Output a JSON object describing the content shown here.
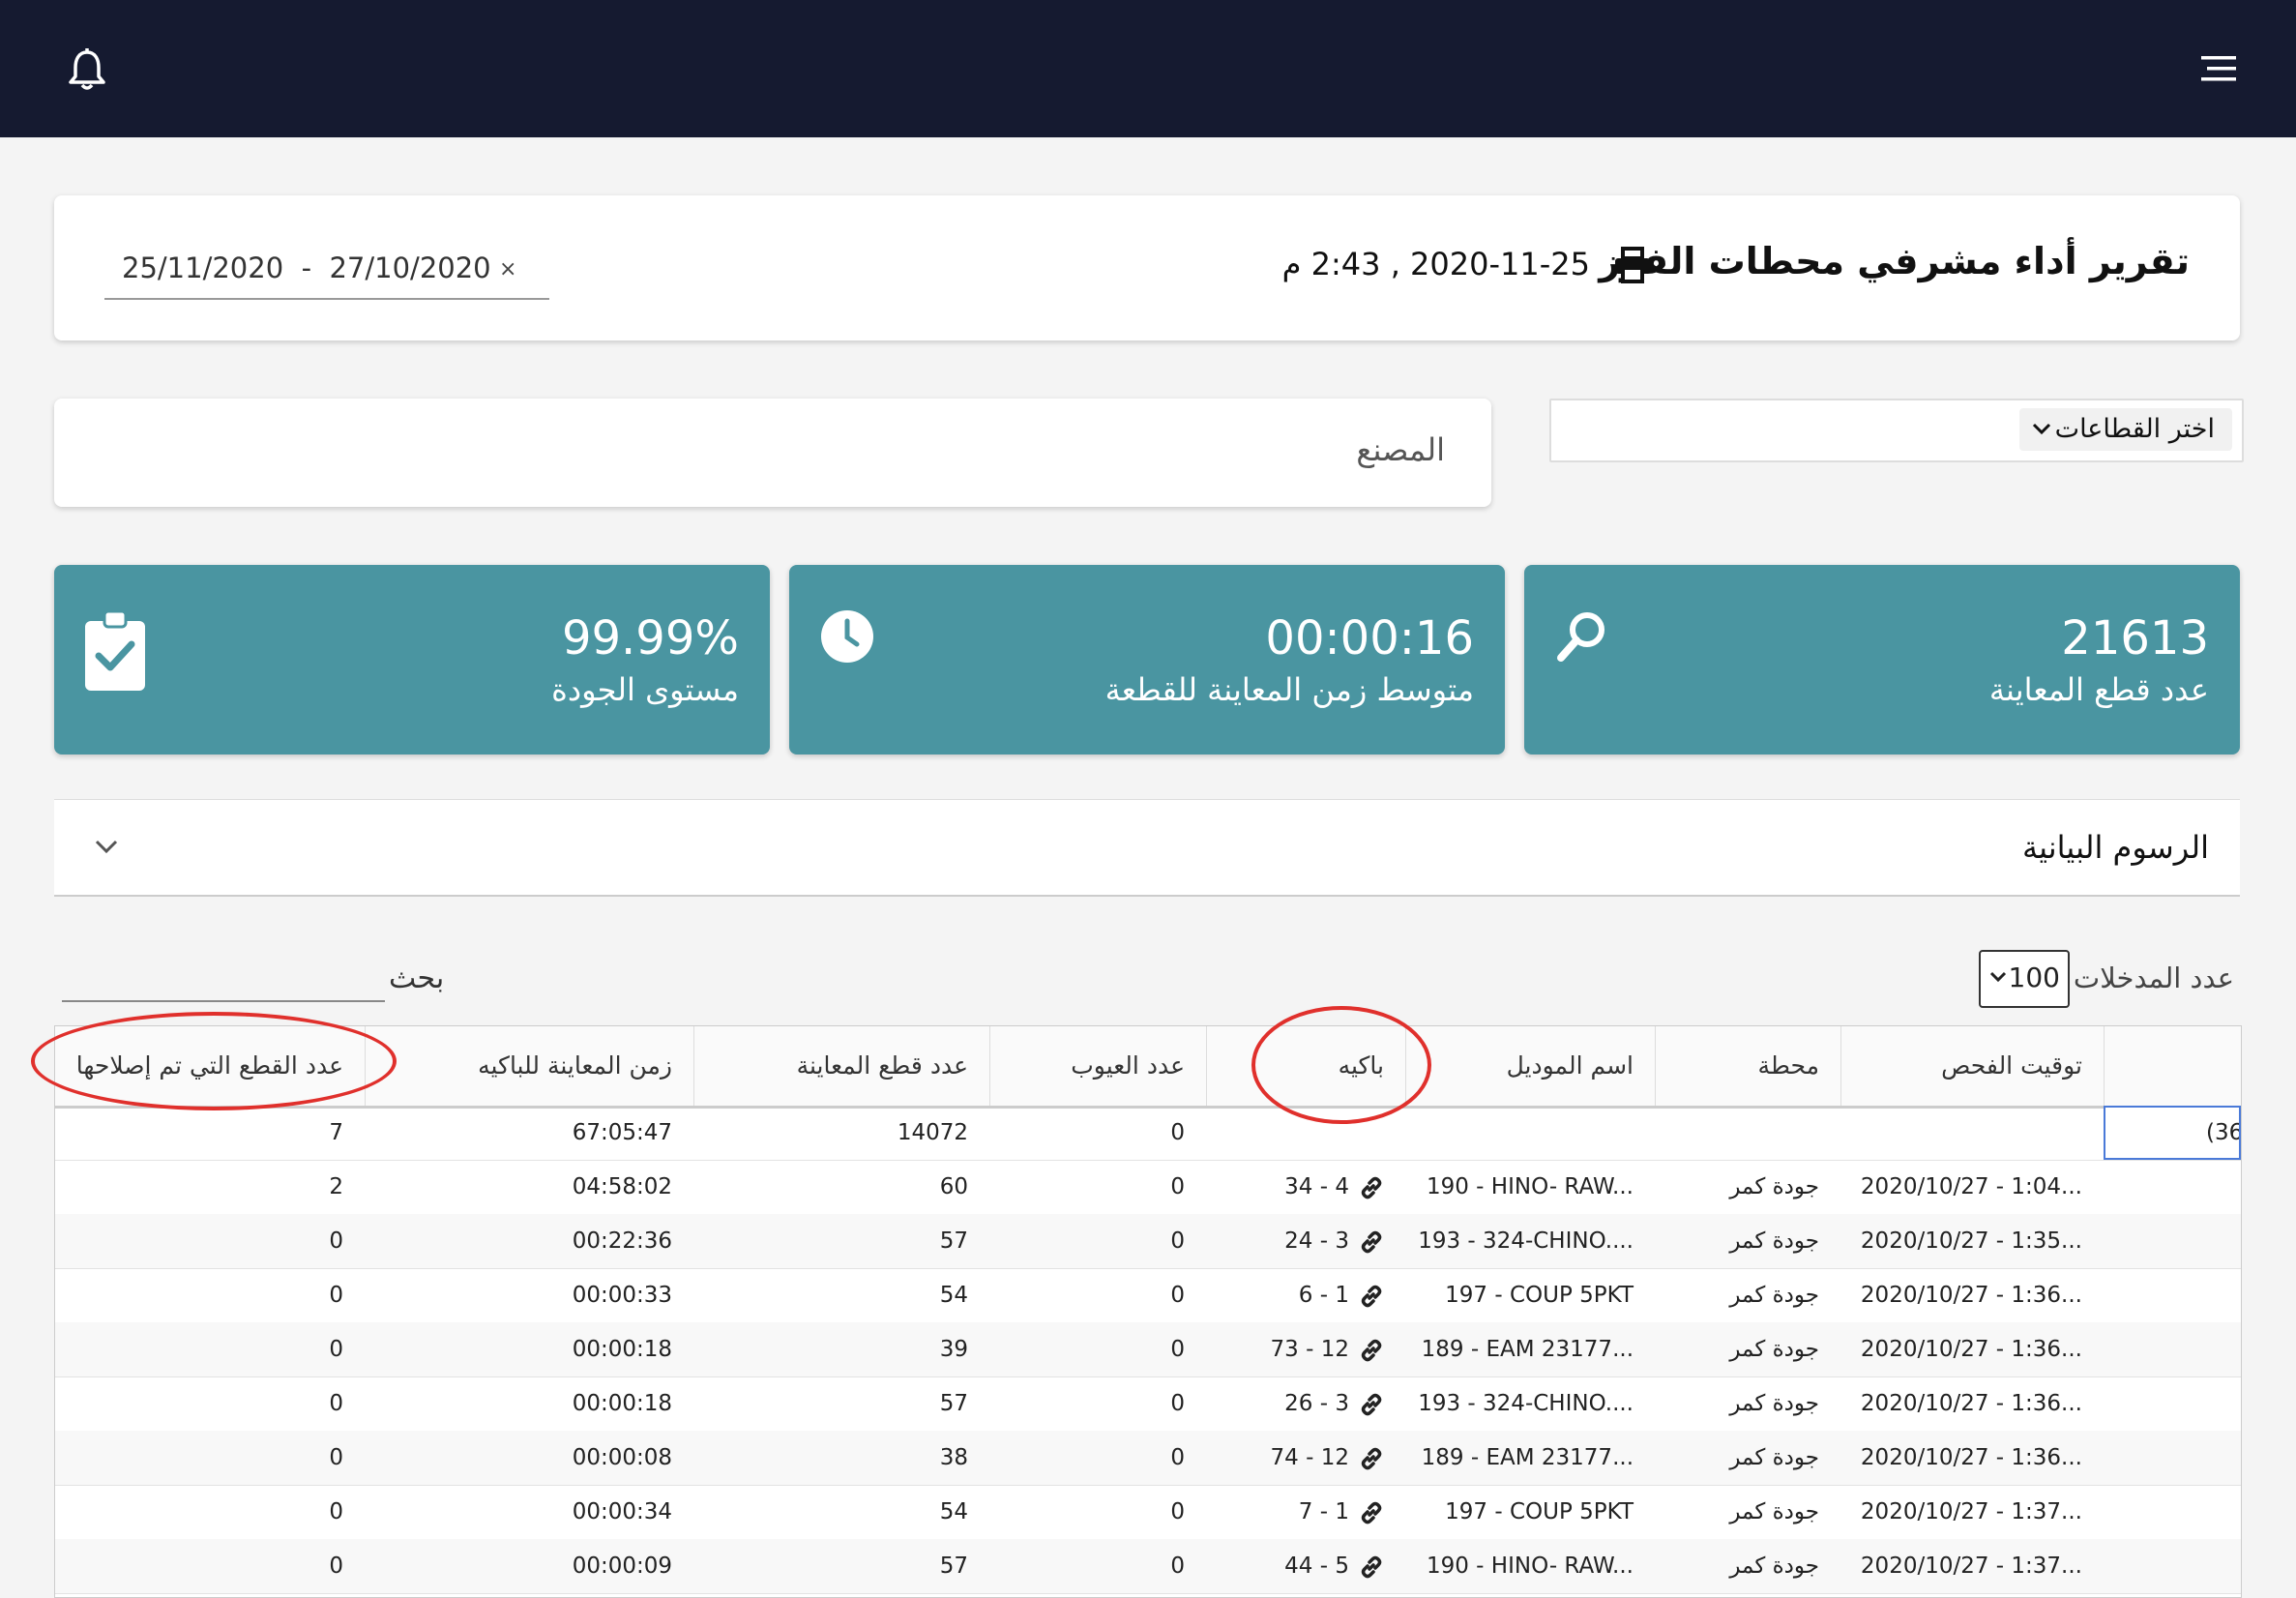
{
  "header": {
    "title": "تقرير أداء مشرفي محطات الفرز",
    "timestamp": "2020-11-25 , 2:43 م",
    "date_range": "25/11/2020  -  27/10/2020",
    "clear_symbol": "×"
  },
  "filters": {
    "sectors_label": "اختر القطاعات",
    "factory_label": "المصنع"
  },
  "stats": [
    {
      "value": "21613",
      "label": "عدد قطع المعاينة",
      "icon": "search-icon"
    },
    {
      "value": "00:00:16",
      "label": "متوسط زمن المعاينة للقطعة",
      "icon": "clock-icon"
    },
    {
      "value": "99.99%",
      "label": "مستوى الجودة",
      "icon": "clipboard-check-icon"
    }
  ],
  "charts": {
    "label": "الرسوم البيانية"
  },
  "table_controls": {
    "entries_label": "عدد المدخلات",
    "entries_value": "100",
    "search_label": "بحث"
  },
  "table": {
    "columns": [
      "توقيت الفحص",
      "محطة",
      "اسم الموديل",
      "باكيه",
      "عدد العيوب",
      "عدد قطع المعاينة",
      "زمن المعاينة للباكيه",
      "عدد القطع التي تم إصلاحها"
    ],
    "total_row": {
      "filter_value": "(36",
      "defects": "0",
      "pieces": "14072",
      "time": "67:05:47",
      "repaired": "7"
    },
    "rows": [
      {
        "time": "2020/10/27 - 1:04...",
        "station": "جودة كمر",
        "model": "190 - HINO- RAW...",
        "bundle": "34 - 4",
        "defects": "0",
        "pieces": "60",
        "duration": "04:58:02",
        "repaired": "2"
      },
      {
        "time": "2020/10/27 - 1:35...",
        "station": "جودة كمر",
        "model": "193 - 324-CHINO....",
        "bundle": "24 - 3",
        "defects": "0",
        "pieces": "57",
        "duration": "00:22:36",
        "repaired": "0"
      },
      {
        "time": "2020/10/27 - 1:36...",
        "station": "جودة كمر",
        "model": "197 - COUP 5PKT",
        "bundle": "6 - 1",
        "defects": "0",
        "pieces": "54",
        "duration": "00:00:33",
        "repaired": "0"
      },
      {
        "time": "2020/10/27 - 1:36...",
        "station": "جودة كمر",
        "model": "189 - EAM 23177...",
        "bundle": "73 - 12",
        "defects": "0",
        "pieces": "39",
        "duration": "00:00:18",
        "repaired": "0"
      },
      {
        "time": "2020/10/27 - 1:36...",
        "station": "جودة كمر",
        "model": "193 - 324-CHINO....",
        "bundle": "26 - 3",
        "defects": "0",
        "pieces": "57",
        "duration": "00:00:18",
        "repaired": "0"
      },
      {
        "time": "2020/10/27 - 1:36...",
        "station": "جودة كمر",
        "model": "189 - EAM 23177...",
        "bundle": "74 - 12",
        "defects": "0",
        "pieces": "38",
        "duration": "00:00:08",
        "repaired": "0"
      },
      {
        "time": "2020/10/27 - 1:37...",
        "station": "جودة كمر",
        "model": "197 - COUP 5PKT",
        "bundle": "7 - 1",
        "defects": "0",
        "pieces": "54",
        "duration": "00:00:34",
        "repaired": "0"
      },
      {
        "time": "2020/10/27 - 1:37...",
        "station": "جودة كمر",
        "model": "190 - HINO- RAW...",
        "bundle": "44 - 5",
        "defects": "0",
        "pieces": "57",
        "duration": "00:00:09",
        "repaired": "0"
      }
    ]
  },
  "colors": {
    "topbar": "#151a30",
    "stat_card": "#4a95a1",
    "annotation": "#e0302c"
  }
}
